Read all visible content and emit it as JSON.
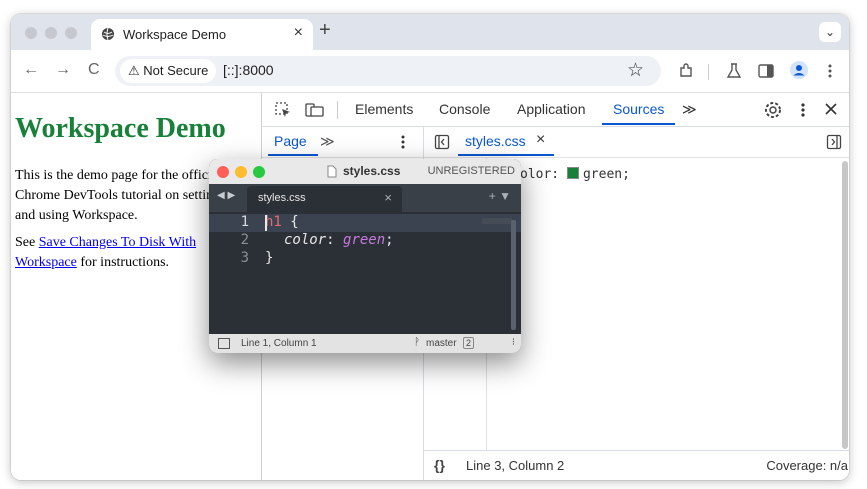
{
  "browser": {
    "tab_title": "Workspace Demo",
    "tab_close": "×",
    "new_tab": "+",
    "tab_menu": "⌄",
    "back": "←",
    "forward": "→",
    "reload": "C",
    "security_label": "Not Secure",
    "url": "[::]:8000",
    "bookmark": "☆"
  },
  "page": {
    "heading": "Workspace Demo",
    "paragraph1": "This is the demo page for the official Chrome DevTools tutorial on setting up and using Workspace.",
    "paragraph2_prefix": "See ",
    "paragraph2_link": "Save Changes To Disk With Workspace",
    "paragraph2_suffix": " for instructions.",
    "heading_color": "#188038"
  },
  "devtools": {
    "tabs": [
      "Elements",
      "Console",
      "Application",
      "Sources"
    ],
    "active_tab": "Sources",
    "more_tabs": "≫",
    "navigator_tab": "Page",
    "navigator_more": "≫",
    "file_tab": "styles.css",
    "file_tab_close": "×",
    "code_line_fragment": "olor: ",
    "code_value": "green;",
    "cursor_position": "Line 3, Column 2",
    "coverage": "Coverage: n/a",
    "accent_color": "#0b57d0"
  },
  "external_editor": {
    "title": "styles.css",
    "unregistered": "UNREGISTERED",
    "tab": "styles.css",
    "tab_close": "×",
    "line_numbers": [
      "1",
      "2",
      "3"
    ],
    "code": {
      "selector": "h1",
      "open_brace": " {",
      "property": "color",
      "colon": ": ",
      "value": "green",
      "semicolon": ";",
      "close_brace": "}"
    },
    "status_position": "Line 1, Column 1",
    "branch": "master",
    "branch_count": "2",
    "status_more": "⁝"
  }
}
